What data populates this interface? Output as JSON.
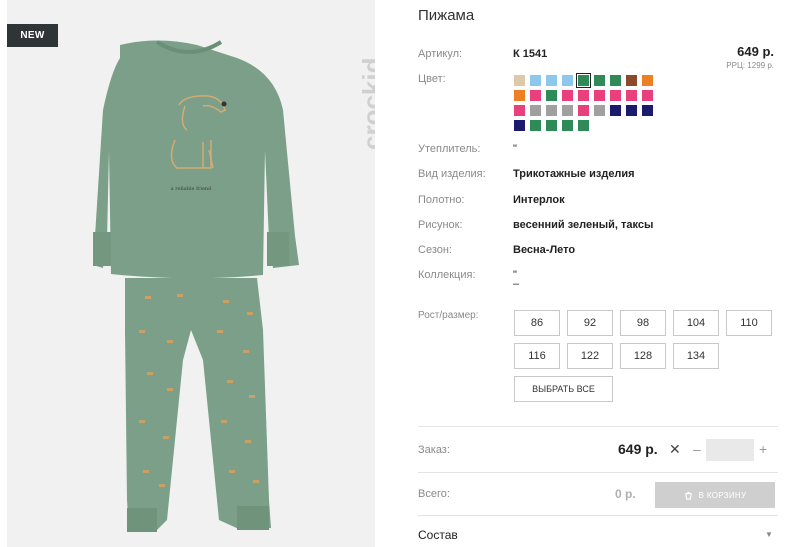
{
  "badge": "NEW",
  "brand": "crockid",
  "product": {
    "title": "Пижама",
    "article_label": "Артикул:",
    "article": "К 1541",
    "price": "649 р.",
    "rrp": "РРЦ: 1299 р.",
    "color_label": "Цвет:",
    "swatches": [
      "#dcc9a8",
      "#8cc8ee",
      "#8cc8ee",
      "#8cc8ee",
      "#2e8b57",
      "#2e8b57",
      "#2e8b57",
      "#8b4a2b",
      "#ee7f22",
      "#ee7f22",
      "#e8407c",
      "#2e8b57",
      "#e8407c",
      "#e8407c",
      "#e8407c",
      "#e8407c",
      "#e8407c",
      "#e8407c",
      "#e8407c",
      "#a0a0a0",
      "#a0a0a0",
      "#a0a0a0",
      "#e8407c",
      "#a0a0a0",
      "#1a1a6e",
      "#1a1a6e",
      "#1a1a6e",
      "#1a1a6e",
      "#2e8b57",
      "#2e8b57",
      "#2e8b57",
      "#2e8b57"
    ],
    "selected_swatch": 4,
    "insulation_label": "Утеплитель:",
    "insulation": "\"",
    "type_label": "Вид изделия:",
    "type": "Трикотажные изделия",
    "fabric_label": "Полотно:",
    "fabric": "Интерлок",
    "pattern_label": "Рисунок:",
    "pattern": "весенний зеленый, таксы",
    "season_label": "Сезон:",
    "season": "Весна-Лето",
    "collection_label": "Коллекция:",
    "collection": "\"",
    "collection_extra": "–",
    "size_label": "Рост/размер:",
    "sizes": [
      "86",
      "92",
      "98",
      "104",
      "110",
      "116",
      "122",
      "128",
      "134"
    ],
    "select_all": "ВЫБРАТЬ ВСЕ"
  },
  "order": {
    "label": "Заказ:",
    "price": "649 р.",
    "times": "✕",
    "minus": "–",
    "qty": "",
    "plus": "+"
  },
  "total": {
    "label": "Всего:",
    "value": "0 р.",
    "cart_button": "В КОРЗИНУ"
  },
  "composition": {
    "title": "Состав",
    "chevron": "▼"
  },
  "print_text": "a reliable friend"
}
